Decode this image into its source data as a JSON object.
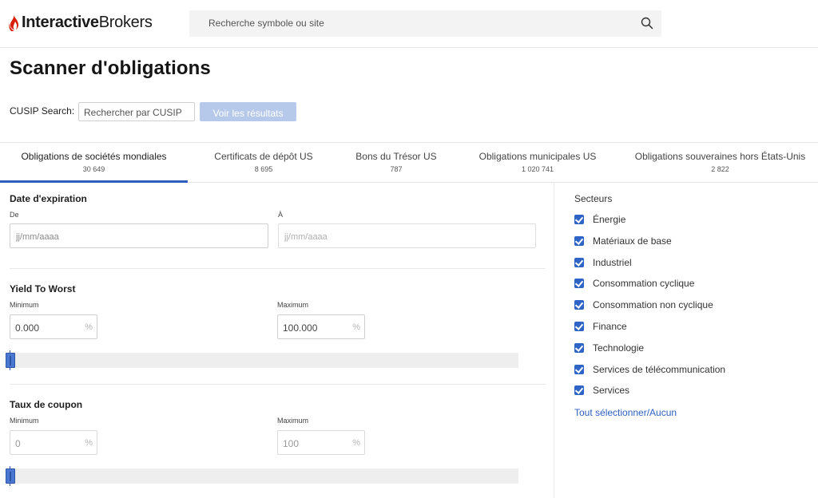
{
  "header": {
    "logo_bold": "Interactive",
    "logo_light": "Brokers",
    "search_placeholder": "Recherche symbole ou site"
  },
  "page": {
    "title": "Scanner d'obligations"
  },
  "cusip": {
    "label": "CUSIP Search:",
    "placeholder": "Rechercher par CUSIP",
    "button": "Voir les résultats"
  },
  "tabs": [
    {
      "label": "Obligations de sociétés mondiales",
      "count": "30 649",
      "active": true
    },
    {
      "label": "Certificats de dépôt US",
      "count": "8 695"
    },
    {
      "label": "Bons du Trésor US",
      "count": "787"
    },
    {
      "label": "Obligations municipales US",
      "count": "1 020 741"
    },
    {
      "label": "Obligations souveraines hors États-Unis",
      "count": "2 822"
    }
  ],
  "expiration": {
    "title": "Date d'expiration",
    "from_label": "De",
    "to_label": "À",
    "from_placeholder": "jj/mm/aaaa",
    "to_placeholder": "jj/mm/aaaa"
  },
  "ytw": {
    "title": "Yield To Worst",
    "min_label": "Minimum",
    "max_label": "Maximum",
    "min_value": "0.000",
    "max_value": "100.000",
    "unit": "%"
  },
  "coupon": {
    "title": "Taux de coupon",
    "min_label": "Minimum",
    "max_label": "Maximum",
    "min_value": "0",
    "max_value": "100",
    "unit": "%"
  },
  "sectors": {
    "title": "Secteurs",
    "items": [
      {
        "label": "Énergie",
        "checked": true
      },
      {
        "label": "Matériaux de base",
        "checked": true
      },
      {
        "label": "Industriel",
        "checked": true
      },
      {
        "label": "Consommation cyclique",
        "checked": true
      },
      {
        "label": "Consommation non cyclique",
        "checked": true
      },
      {
        "label": "Finance",
        "checked": true
      },
      {
        "label": "Technologie",
        "checked": true
      },
      {
        "label": "Services de télécommunication",
        "checked": true
      },
      {
        "label": "Services",
        "checked": true
      }
    ],
    "select_all": "Tout sélectionner/Aucun"
  },
  "colors": {
    "accent": "#2e5fbf",
    "button_disabled": "#b6c9ea",
    "checkbox": "#2e64c6",
    "logo_red": "#d81e05"
  }
}
